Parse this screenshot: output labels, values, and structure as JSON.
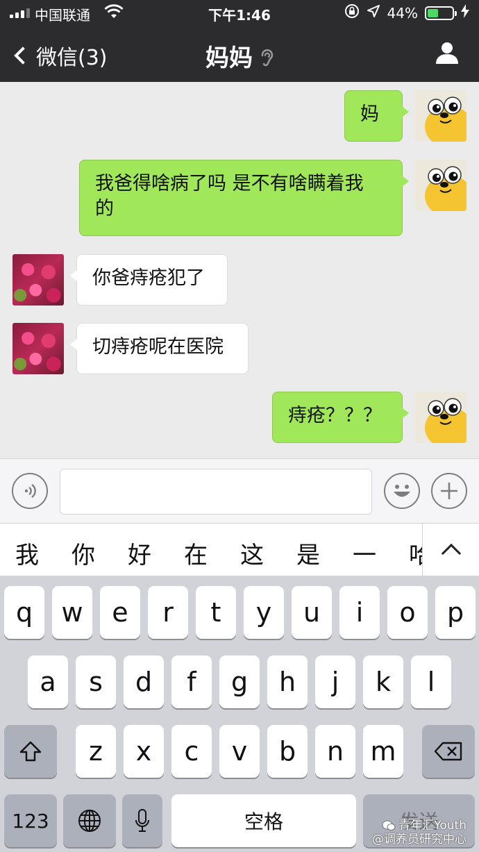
{
  "status_bar": {
    "carrier": "中国联通",
    "time": "下午1:46",
    "battery_percent": "44%",
    "battery_level": 0.44
  },
  "nav": {
    "back_label": "微信(3)",
    "title": "妈妈",
    "ear_icon": "ear-icon",
    "profile_icon": "person-icon"
  },
  "messages": [
    {
      "side": "out",
      "text": "妈"
    },
    {
      "side": "out",
      "text_line1": "我爸得啥病了吗 是不有啥瞒着我",
      "text_line2": "的"
    },
    {
      "side": "in",
      "text": "你爸痔疮犯了"
    },
    {
      "side": "in",
      "text": "切痔疮呢在医院"
    },
    {
      "side": "out",
      "text": "痔疮？？？"
    }
  ],
  "input": {
    "value": "",
    "voice_icon": "voice-icon",
    "emoji_icon": "emoji-icon",
    "plus_icon": "plus-icon"
  },
  "candidates": [
    "我",
    "你",
    "好",
    "在",
    "这",
    "是",
    "一",
    "哈"
  ],
  "keyboard": {
    "row1": [
      "q",
      "w",
      "e",
      "r",
      "t",
      "y",
      "u",
      "i",
      "o",
      "p"
    ],
    "row2": [
      "a",
      "s",
      "d",
      "f",
      "g",
      "h",
      "j",
      "k",
      "l"
    ],
    "row3": [
      "z",
      "x",
      "c",
      "v",
      "b",
      "n",
      "m"
    ],
    "numbers_label": "123",
    "space_label": "空格",
    "send_label": "发送"
  },
  "watermark": {
    "line1": "青年汇Youth",
    "line2": "@调养员研究中心"
  }
}
